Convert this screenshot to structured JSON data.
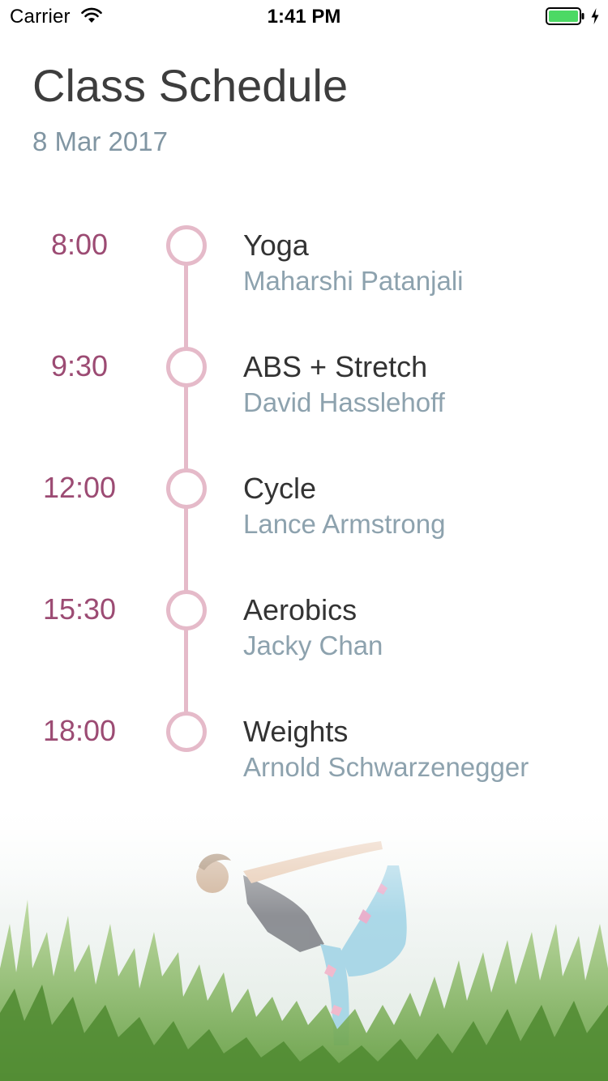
{
  "status_bar": {
    "carrier": "Carrier",
    "time": "1:41 PM",
    "battery_color": "#4cd964"
  },
  "header": {
    "title": "Class Schedule",
    "date": "8 Mar 2017"
  },
  "colors": {
    "time_text": "#9c4b73",
    "timeline": "#e5bac9",
    "title_text": "#333333",
    "instructor_text": "#8da2ae"
  },
  "schedule": [
    {
      "time": "8:00",
      "class": "Yoga",
      "instructor": "Maharshi Patanjali"
    },
    {
      "time": "9:30",
      "class": "ABS + Stretch",
      "instructor": "David Hasslehoff"
    },
    {
      "time": "12:00",
      "class": "Cycle",
      "instructor": "Lance Armstrong"
    },
    {
      "time": "15:30",
      "class": "Aerobics",
      "instructor": "Jacky Chan"
    },
    {
      "time": "18:00",
      "class": "Weights",
      "instructor": "Arnold Schwarzenegger"
    }
  ],
  "background_image": {
    "icon": "yoga-photo"
  }
}
